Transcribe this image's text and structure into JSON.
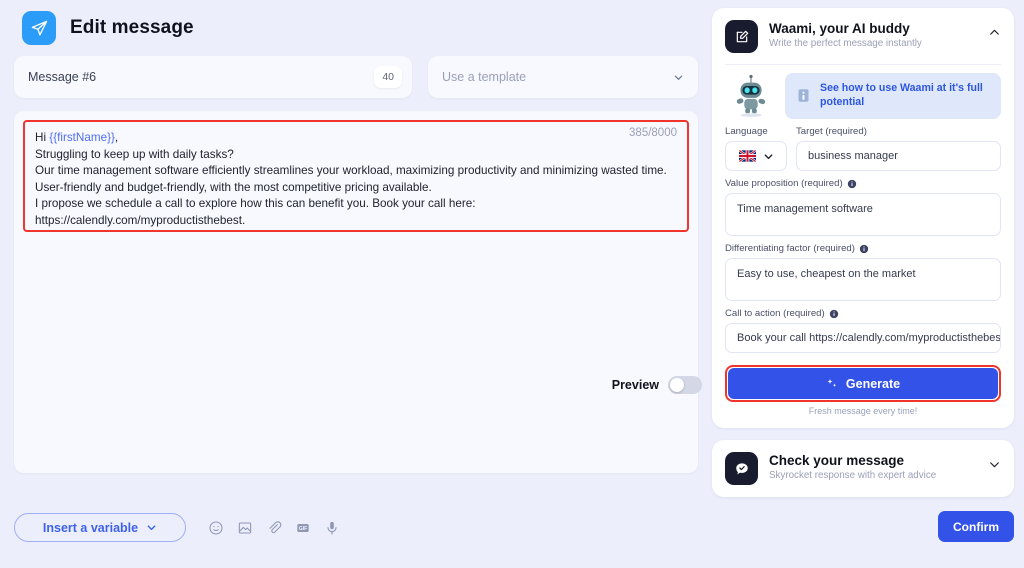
{
  "header": {
    "title": "Edit message",
    "logo_icon": "send-plane-icon"
  },
  "message_meta": {
    "name_label": "Message #6",
    "name_count": "40",
    "template_placeholder": "Use a template",
    "template_chevron_icon": "chevron-down-icon"
  },
  "editor": {
    "char_count": "385/8000",
    "body_greeting_prefix": "Hi ",
    "body_variable": "{{firstName}}",
    "body_after_variable": ",",
    "body_rest": "Struggling to keep up with daily tasks?\nOur time management software efficiently streamlines your workload, maximizing productivity and minimizing wasted time.\nUser-friendly and budget-friendly, with the most competitive pricing available.\nI propose we schedule a call to explore how this can benefit you. Book your call here:\nhttps://calendly.com/myproductisthebest.",
    "highlight_color": "#f0342e",
    "variable_color": "#4f6ef0"
  },
  "preview": {
    "label": "Preview",
    "enabled": false
  },
  "bottom_toolbar": {
    "insert_variable_label": "Insert a variable",
    "insert_variable_chevron_icon": "chevron-down-icon",
    "icons": [
      {
        "name": "emoji-icon"
      },
      {
        "name": "image-icon"
      },
      {
        "name": "attachment-icon"
      },
      {
        "name": "gif-icon"
      },
      {
        "name": "microphone-icon"
      }
    ]
  },
  "confirm_button": {
    "label": "Confirm"
  },
  "waami_panel": {
    "title": "Waami, your AI buddy",
    "subtitle": "Write the perfect message instantly",
    "icon": "compose-edit-icon",
    "collapse_icon": "chevron-up-icon",
    "mascot_icon": "robot-mascot-icon",
    "info_banner": {
      "icon": "info-icon",
      "text": "See how to use Waami at it's full potential"
    },
    "language": {
      "label": "Language",
      "flag_icon": "uk-flag-icon",
      "chevron_icon": "chevron-down-icon"
    },
    "target": {
      "label": "Target (required)",
      "value": "business manager"
    },
    "value_proposition": {
      "label": "Value proposition (required)",
      "info_icon": "info-circle-icon",
      "value": "Time management software"
    },
    "differentiating_factor": {
      "label": "Differentiating factor (required)",
      "info_icon": "info-circle-icon",
      "value": "Easy to use, cheapest on the market"
    },
    "call_to_action": {
      "label": "Call to action (required)",
      "info_icon": "info-circle-icon",
      "value": "Book your call https://calendly.com/myproductisthebest"
    },
    "generate": {
      "label": "Generate",
      "icon": "sparkle-icon",
      "note": "Fresh message every time!",
      "color": "#3353e8"
    }
  },
  "check_panel": {
    "title": "Check your message",
    "subtitle": "Skyrocket response with expert advice",
    "icon": "chat-check-icon",
    "expand_icon": "chevron-down-icon"
  }
}
